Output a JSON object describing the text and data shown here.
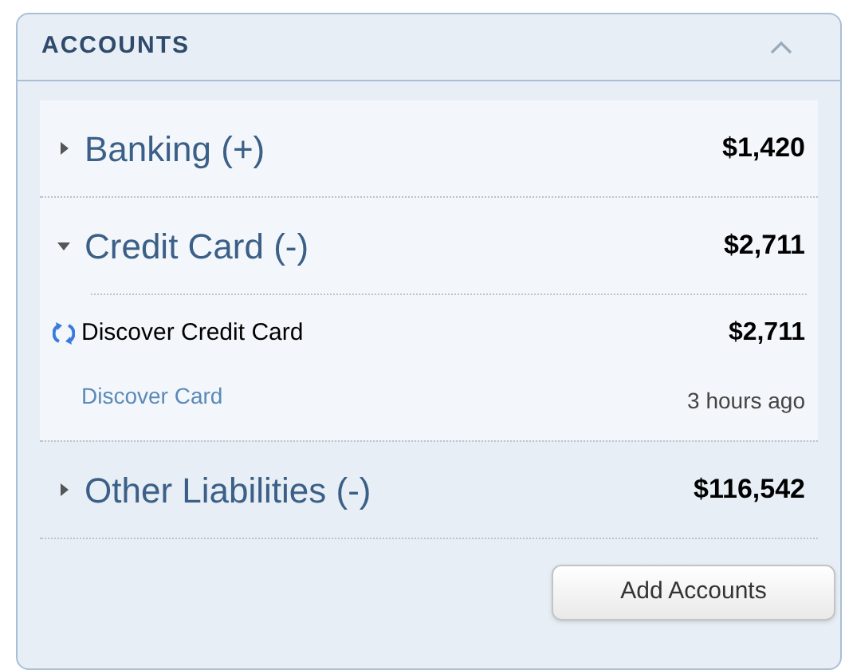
{
  "panel": {
    "title": "ACCOUNTS",
    "collapsed": false
  },
  "groups": [
    {
      "name": "Banking (+)",
      "total": "$1,420",
      "expanded": false,
      "highlighted": true
    },
    {
      "name": "Credit Card (-)",
      "total": "$2,711",
      "expanded": true,
      "highlighted": true,
      "accounts": [
        {
          "name": "Discover Credit Card",
          "amount": "$2,711",
          "institution": "Discover Card",
          "updated": "3 hours ago",
          "syncing": true
        }
      ]
    },
    {
      "name": "Other Liabilities (-)",
      "total": "$116,542",
      "expanded": false,
      "highlighted": false
    }
  ],
  "add_button": "Add Accounts"
}
